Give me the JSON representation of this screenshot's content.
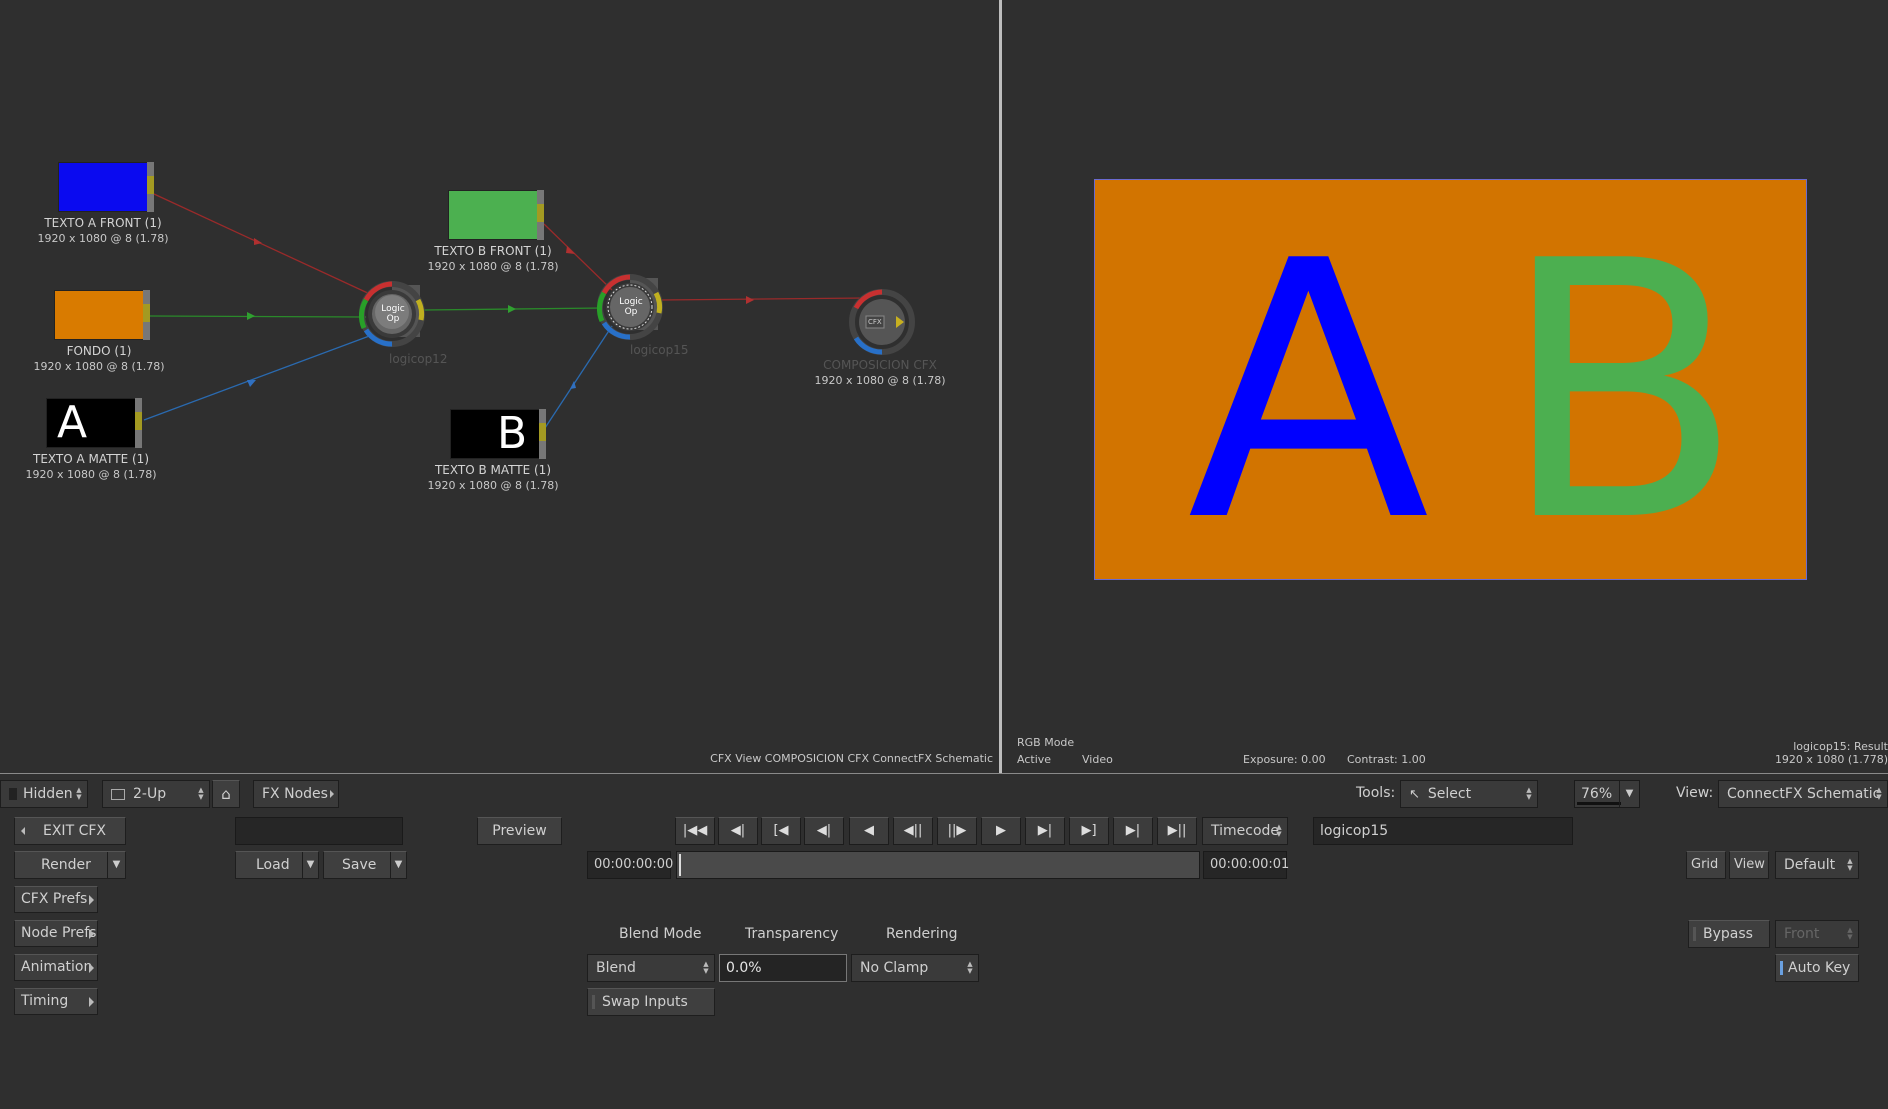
{
  "schematic": {
    "nodes": {
      "texto_a_front": {
        "name": "TEXTO A FRONT (1)",
        "res": "1920 x 1080 @ 8 (1.78)",
        "color": "#0a0af0"
      },
      "fondo": {
        "name": "FONDO (1)",
        "res": "1920 x 1080 @ 8 (1.78)",
        "color": "#d97b00"
      },
      "texto_a_matte": {
        "name": "TEXTO A MATTE (1)",
        "res": "1920 x 1080 @ 8 (1.78)",
        "glyph": "A"
      },
      "texto_b_front": {
        "name": "TEXTO B FRONT (1)",
        "res": "1920 x 1080 @ 8 (1.78)",
        "color": "#4cb050"
      },
      "texto_b_matte": {
        "name": "TEXTO B MATTE (1)",
        "res": "1920 x 1080 @ 8 (1.78)",
        "glyph": "B"
      },
      "logicop12": {
        "name": "logicop12",
        "icon_text": "Logic Op"
      },
      "logicop15": {
        "name": "logicop15",
        "icon_text": "Logic Op"
      },
      "composicion": {
        "name": "COMPOSICION CFX",
        "res": "1920 x 1080 @ 8 (1.78)",
        "icon_text": "CFX"
      }
    },
    "footer": "CFX View COMPOSICION CFX ConnectFX Schematic"
  },
  "viewer": {
    "letters": [
      "A",
      "B"
    ],
    "bg_color": "#d27400",
    "letter_a_color": "#0000ff",
    "letter_b_color": "#4caf50",
    "mode": "RGB Mode",
    "active": "Active",
    "video": "Video",
    "exposure": "Exposure: 0.00",
    "contrast": "Contrast: 1.00",
    "result_name": "logicop15: Result",
    "result_res": "1920 x 1080 (1.778)"
  },
  "toolbar": {
    "hidden": "Hidden",
    "layout": "2-Up",
    "fx_nodes": "FX Nodes",
    "tools_label": "Tools:",
    "tool_select": "Select",
    "zoom": "76%",
    "view_label": "View:",
    "view_value": "ConnectFX Schematic"
  },
  "controls": {
    "exit_cfx": "EXIT CFX",
    "render": "Render",
    "cfx_prefs": "CFX Prefs",
    "node_prefs": "Node Prefs",
    "animation": "Animation",
    "timing": "Timing",
    "name_field": "",
    "preview": "Preview",
    "load": "Load",
    "save": "Save",
    "timecode": "Timecode",
    "node_name": "logicop15",
    "tc_start": "00:00:00:00",
    "tc_end": "00:00:00:01",
    "grid": "Grid",
    "view": "View",
    "default": "Default",
    "bypass": "Bypass",
    "front": "Front",
    "auto_key": "Auto Key"
  },
  "transport": [
    "|◀◀",
    "◀|",
    "[◀",
    "◀|",
    "◀",
    "◀||",
    "||▶",
    "▶",
    "▶|",
    "▶]",
    "▶|",
    "▶||"
  ],
  "params": {
    "blend_mode_label": "Blend Mode",
    "transparency_label": "Transparency",
    "rendering_label": "Rendering",
    "blend_mode": "Blend",
    "transparency": "0.0%",
    "rendering": "No Clamp",
    "swap_inputs": "Swap Inputs"
  }
}
